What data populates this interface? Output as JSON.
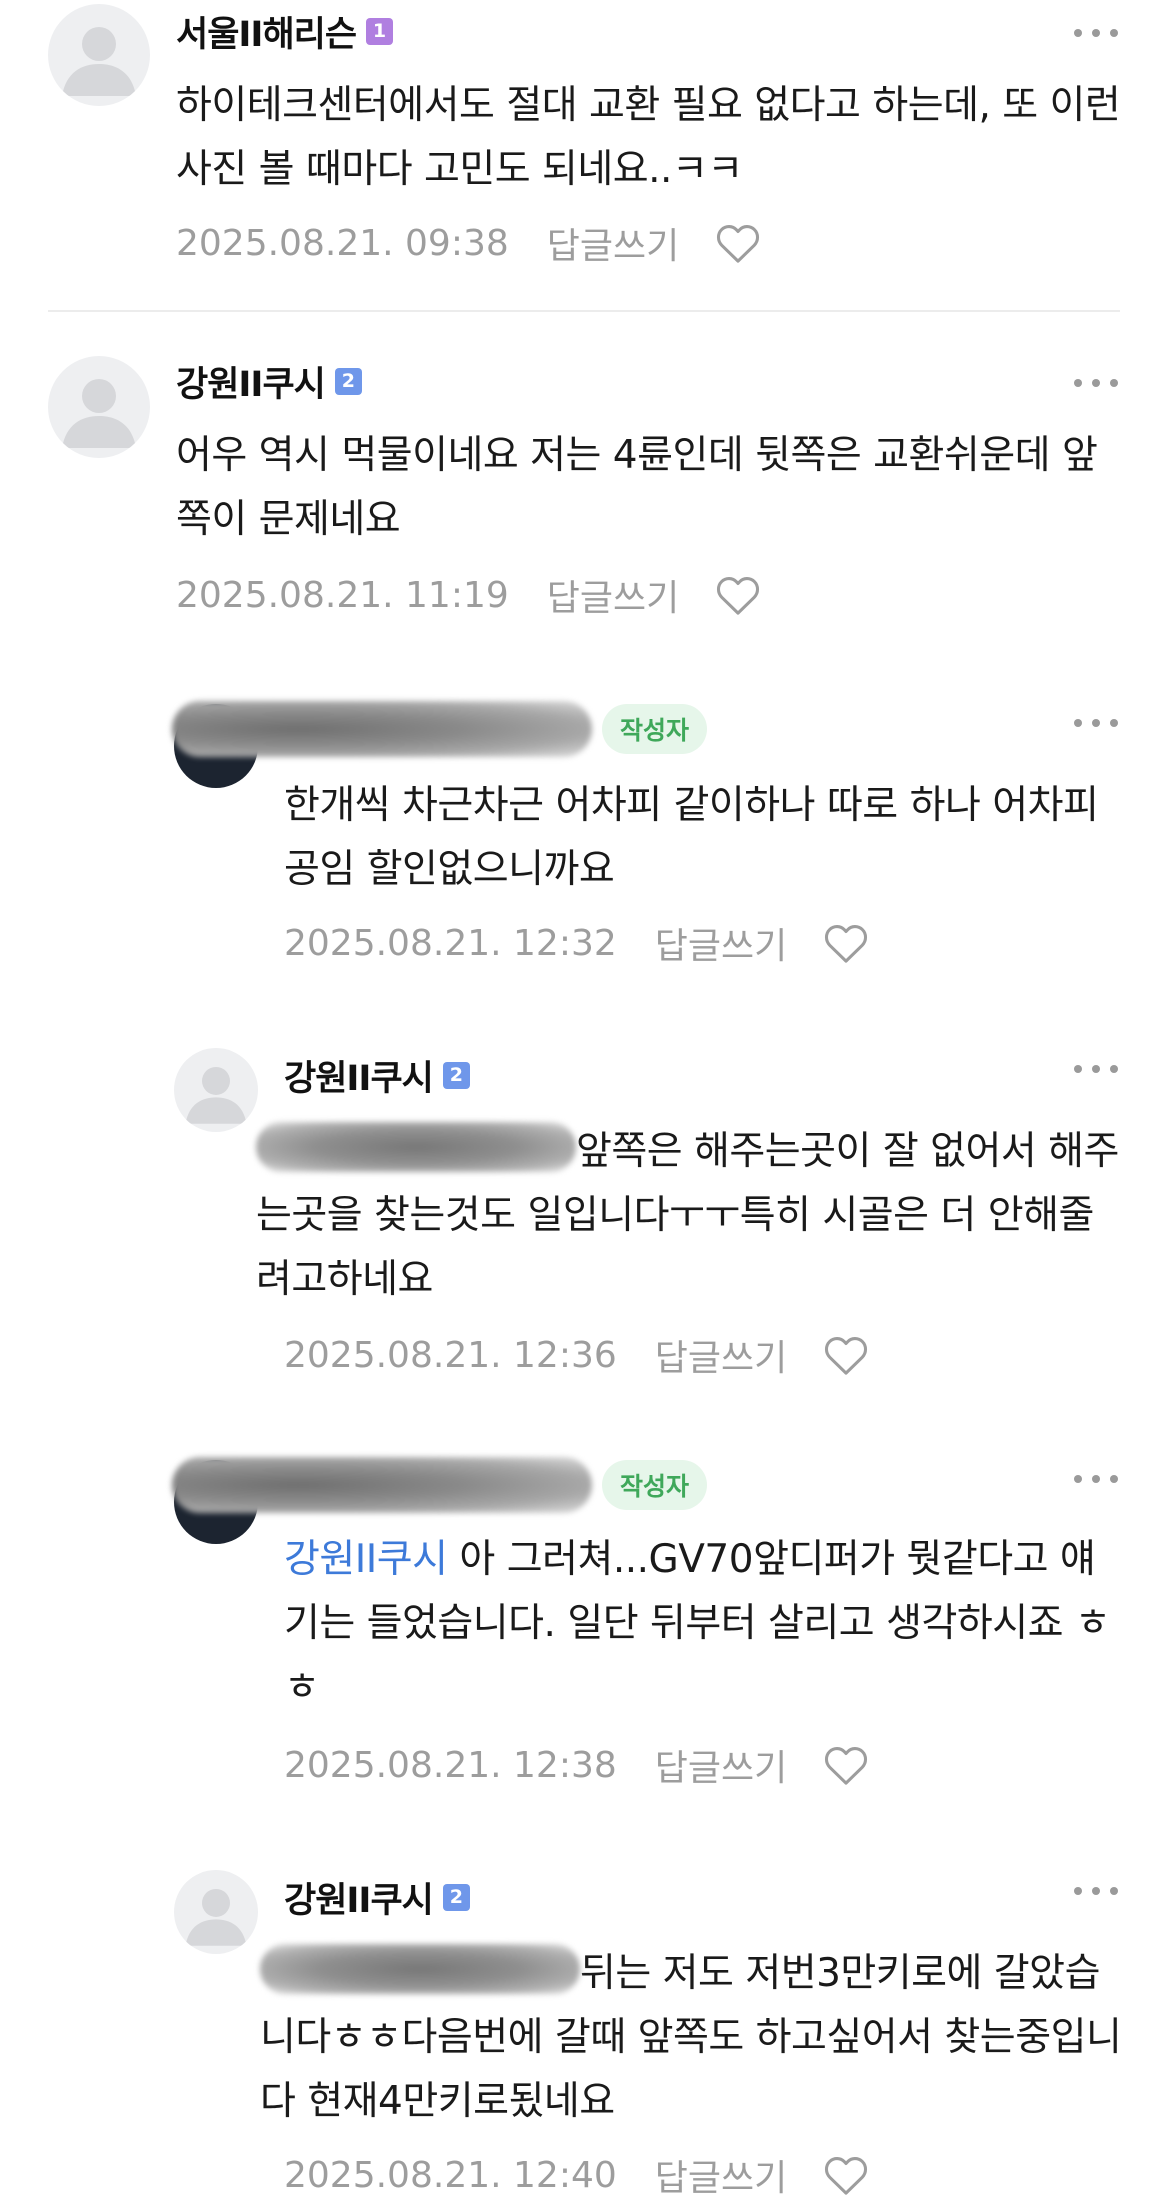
{
  "comments": [
    {
      "author": "서울II해리슨",
      "level": "1",
      "text": "하이테크센터에서도 절대 교환 필요 없다고 하는데, 또 이런 사진 볼 때마다 고민도 되네요..ㅋㅋ",
      "date": "2025.08.21. 09:38",
      "reply_label": "답글쓰기"
    },
    {
      "author": "강원II쿠시",
      "level": "2",
      "text": "어우 역시 먹물이네요 저는 4륜인데 뒷쪽은 교환쉬운데 앞쪽이 문제네요",
      "date": "2025.08.21. 11:19",
      "reply_label": "답글쓰기"
    },
    {
      "author_badge": "작성자",
      "text": "한개씩 차근차근 어차피 같이하나 따로 하나 어차피 공임 할인없으니까요",
      "date": "2025.08.21. 12:32",
      "reply_label": "답글쓰기"
    },
    {
      "author": "강원II쿠시",
      "level": "2",
      "text": "앞쪽은 해주는곳이 잘 없어서 해주는곳을 찾는것도 일입니다ㅜㅜ특히 시골은 더 안해줄려고하네요",
      "date": "2025.08.21. 12:36",
      "reply_label": "답글쓰기"
    },
    {
      "author_badge": "작성자",
      "mention": "강원II쿠시",
      "text": " 아 그러쳐...GV70앞디퍼가 뭣같다고 얘기는 들었습니다. 일단 뒤부터 살리고 생각하시죠 ㅎㅎ",
      "date": "2025.08.21. 12:38",
      "reply_label": "답글쓰기"
    },
    {
      "author": "강원II쿠시",
      "level": "2",
      "text": "뒤는 저도 저번3만키로에 갈았습니다ㅎㅎ다음번에 갈때 앞쪽도 하고싶어서 찾는중입니다 현재4만키로됬네요",
      "date": "2025.08.21. 12:40",
      "reply_label": "답글쓰기"
    }
  ],
  "icons": {
    "more": "more-dots-icon",
    "like": "heart-icon",
    "avatar": "default-avatar-icon"
  },
  "colors": {
    "mention": "#3d7ad9",
    "meta": "#9d9d9d",
    "author_badge_bg": "#e6f6ea",
    "author_badge_text": "#3fa85a",
    "level1": "#b07fe0",
    "level2": "#6f97ea"
  }
}
